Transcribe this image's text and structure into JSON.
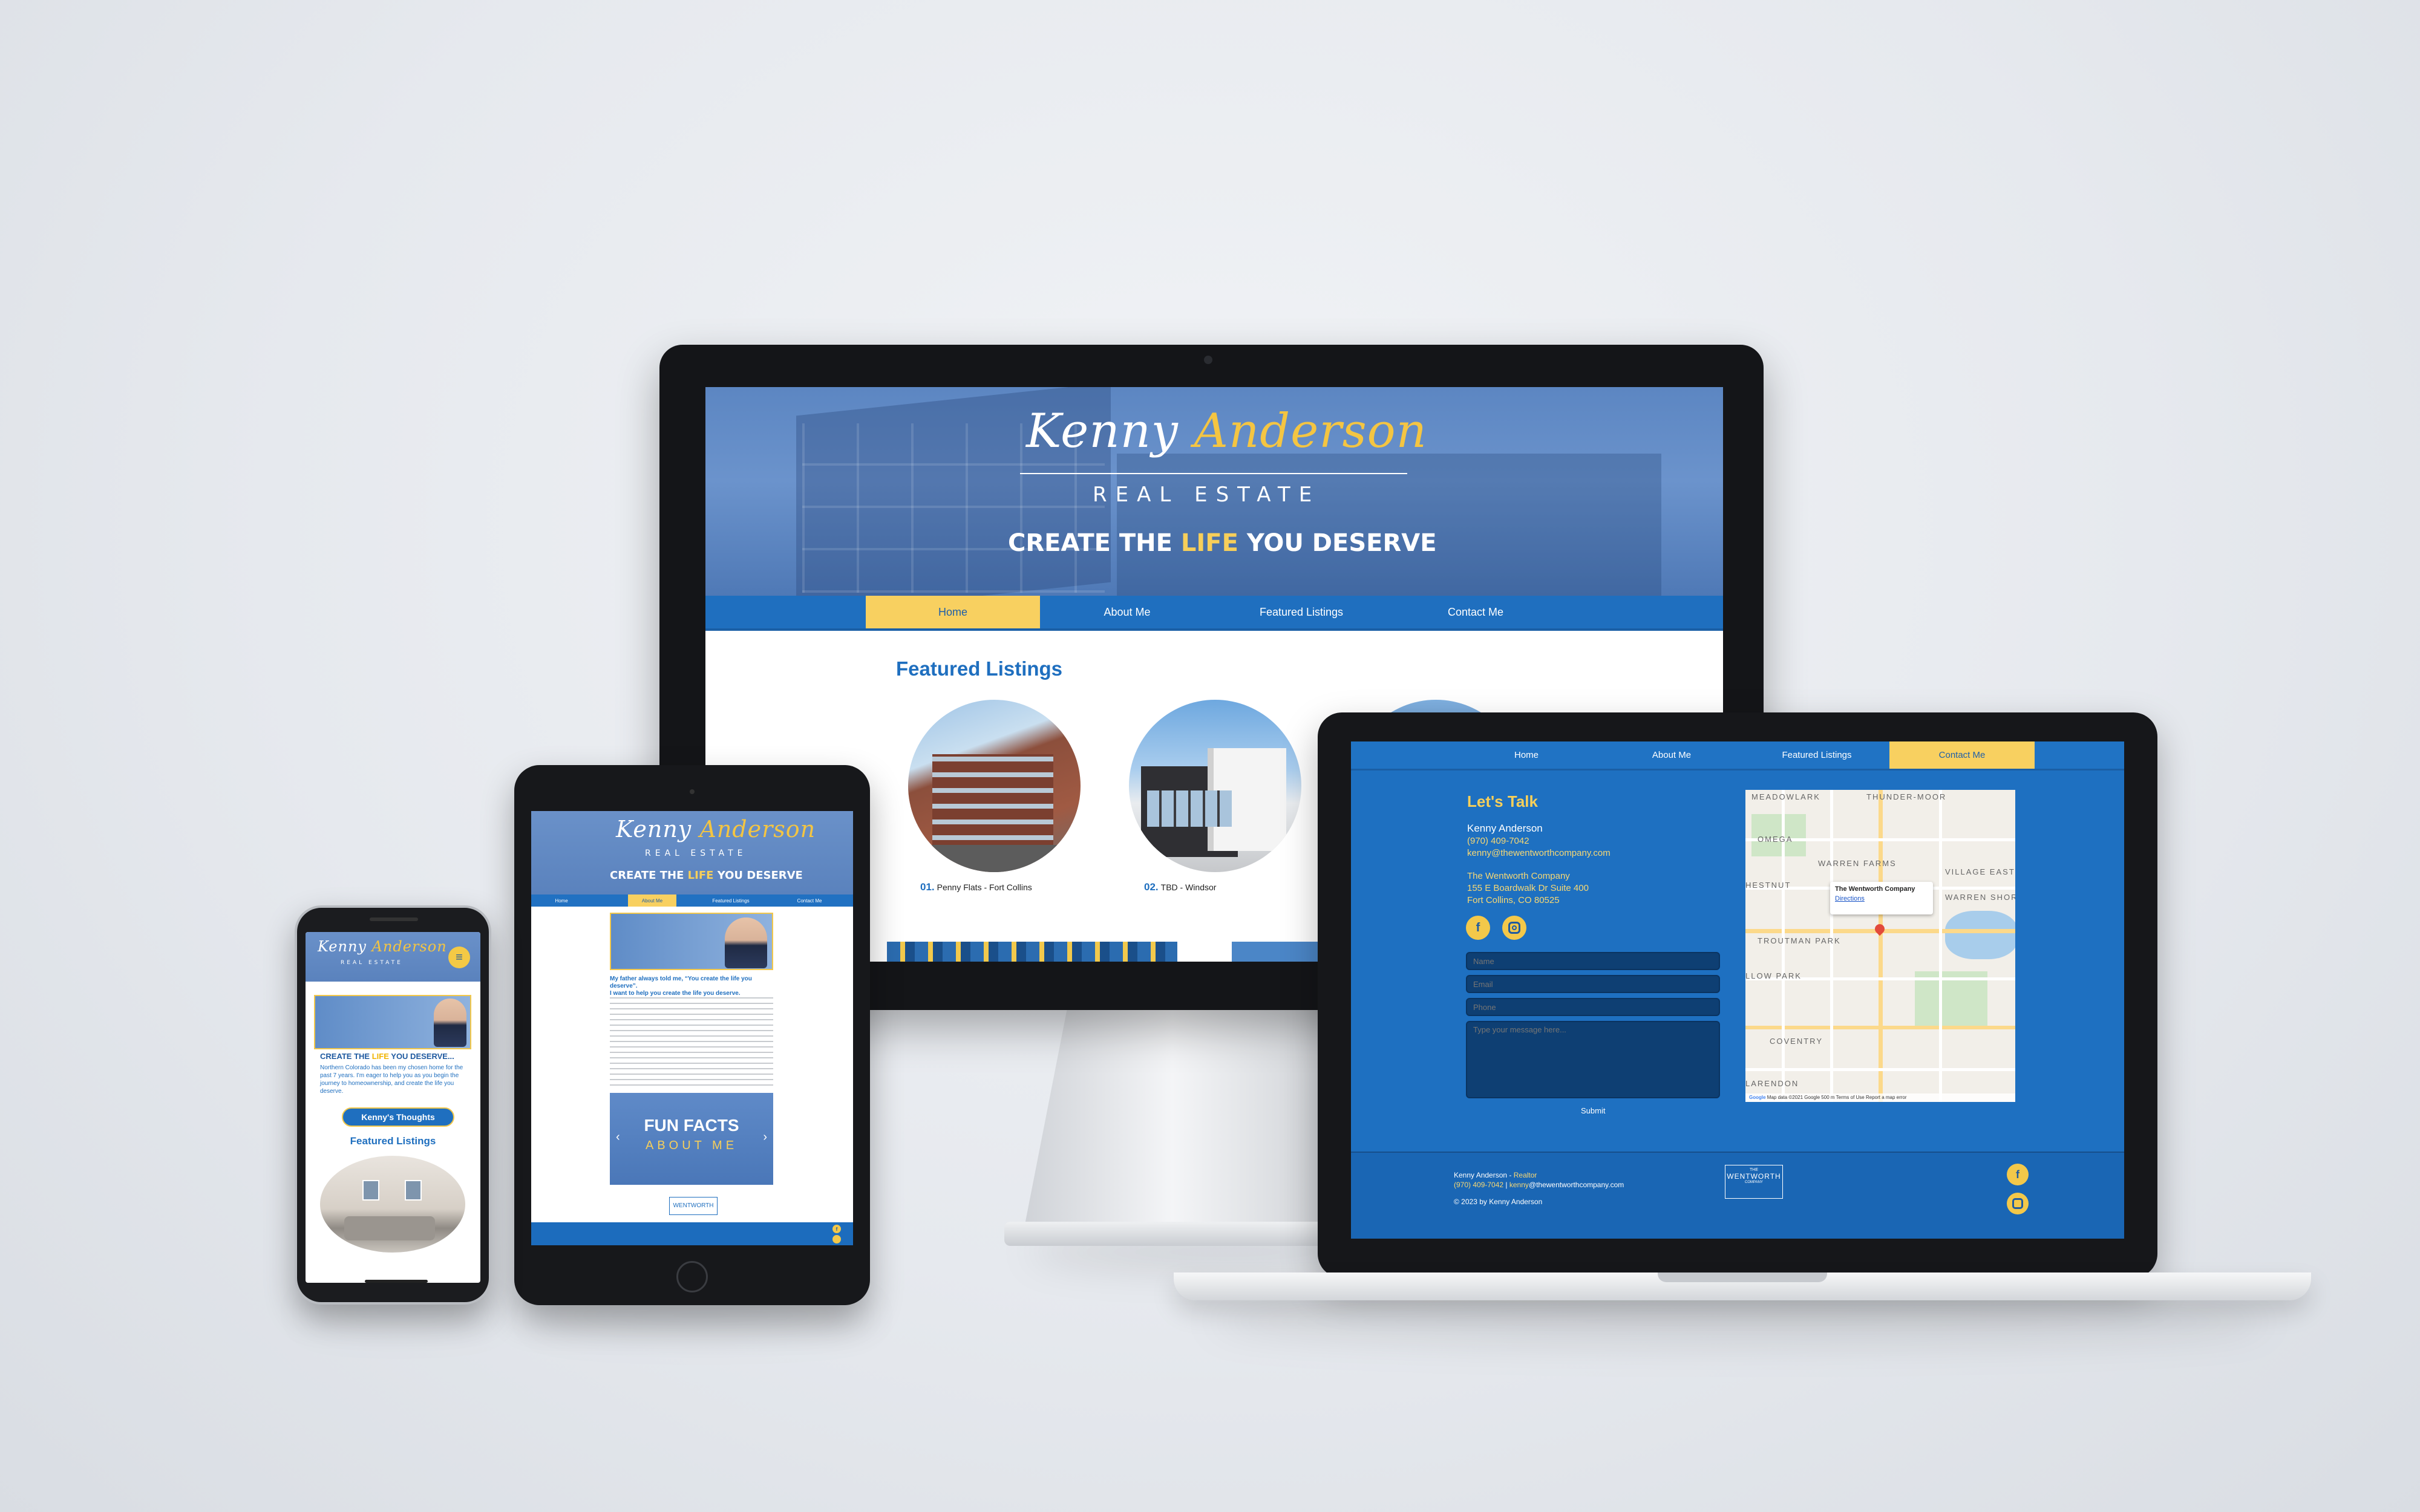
{
  "brand": {
    "name_first": "Kenny",
    "name_last": "Anderson",
    "subtitle": "REAL ESTATE",
    "tagline_pre": "CREATE THE ",
    "tagline_highlight": "LIFE",
    "tagline_post": " YOU DESERVE"
  },
  "colors": {
    "primary_blue": "#1f6fbf",
    "accent_yellow": "#f8d060",
    "dark_blue": "#0e3f73"
  },
  "monitor": {
    "nav": [
      {
        "label": "Home",
        "active": true
      },
      {
        "label": "About Me",
        "active": false
      },
      {
        "label": "Featured Listings",
        "active": false
      },
      {
        "label": "Contact Me",
        "active": false
      }
    ],
    "section_title": "Featured Listings",
    "listings": [
      {
        "num": "01.",
        "label": "Penny Flats - Fort Collins"
      },
      {
        "num": "02.",
        "label": "TBD - Windsor"
      }
    ]
  },
  "laptop": {
    "nav": [
      {
        "label": "Home",
        "active": false
      },
      {
        "label": "About Me",
        "active": false
      },
      {
        "label": "Featured Listings",
        "active": false
      },
      {
        "label": "Contact Me",
        "active": true
      }
    ],
    "heading": "Let's Talk",
    "contact": {
      "name": "Kenny Anderson",
      "phone": "(970) 409-7042",
      "email": "kenny@thewentworthcompany.com",
      "company": "The Wentworth Company",
      "address1": "155 E Boardwalk Dr Suite 400",
      "address2": "Fort Collins, CO 80525"
    },
    "social_icons": [
      "facebook-icon",
      "instagram-icon"
    ],
    "form": {
      "name_placeholder": "Name",
      "email_placeholder": "Email",
      "phone_placeholder": "Phone",
      "message_placeholder": "Type your message here...",
      "submit_label": "Submit"
    },
    "map": {
      "labels": [
        "MEADOWLARK",
        "THUNDER-MOOR",
        "OMEGA",
        "WARREN FARMS",
        "VILLAGE EAST",
        "HESTNUT",
        "WARREN SHORES",
        "TROUTMAN PARK",
        "LLOW PARK",
        "COVENTRY",
        "LARENDON"
      ],
      "info_title": "The Wentworth Company",
      "info_link": "Directions",
      "attribution": "Map data ©2021 Google   500 m        Terms of Use    Report a map error",
      "google_logo": "Google"
    },
    "footer": {
      "line1_name": "Kenny Anderson - ",
      "line1_role": "Realtor",
      "line2_phone": "(970) 409-7042",
      "line2_sep": "  |  ",
      "line2_email_user": "kenny",
      "line2_email_rest": "@thewentworthcompany.com",
      "copyright": "© 2023 by Kenny Anderson",
      "badge_small": "THE",
      "badge_main": "WENTWORTH",
      "badge_sub": "COMPANY"
    }
  },
  "tablet": {
    "nav": [
      "Home",
      "About Me",
      "Featured Listings",
      "Contact Me"
    ],
    "active_index": 1,
    "quote_line1": "My father always told me, “You create the life you deserve”.",
    "quote_line2": "I want to help you create the life you deserve.",
    "fun_facts_title": "FUN FACTS",
    "fun_facts_sub": "ABOUT ME",
    "badge": "WENTWORTH"
  },
  "phone": {
    "headline_pre": "CREATE THE ",
    "headline_highlight": "LIFE",
    "headline_post": " YOU DESERVE...",
    "intro": "Northern Colorado has been my chosen home for the past 7 years.  I'm eager to help you as you begin the journey to homeownership, and create the life you deserve.",
    "button": "Kenny's Thoughts",
    "section_title": "Featured Listings"
  }
}
